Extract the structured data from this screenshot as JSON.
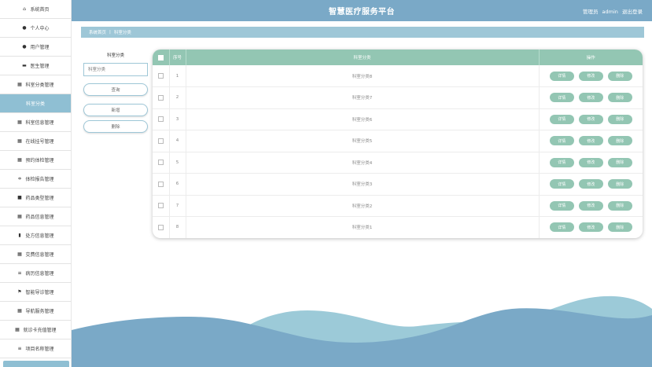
{
  "header": {
    "title": "智慧医疗服务平台",
    "role_prefix": "管理员",
    "username": "admin",
    "logout_label": "退出登录"
  },
  "sidebar": {
    "items": [
      {
        "label": "系统首页",
        "icon": "home-icon",
        "glyph": "⌂"
      },
      {
        "label": "个人中心",
        "icon": "user-icon",
        "glyph": "●"
      },
      {
        "label": "用户管理",
        "icon": "user-icon",
        "glyph": "●"
      },
      {
        "label": "医生管理",
        "icon": "briefcase-icon",
        "glyph": "▬"
      },
      {
        "label": "科室分类管理",
        "icon": "grid-icon",
        "glyph": "▦"
      },
      {
        "label": "科室分类",
        "icon": "",
        "glyph": "",
        "active": true
      },
      {
        "label": "科室信息管理",
        "icon": "grid-icon",
        "glyph": "▦"
      },
      {
        "label": "在线挂号管理",
        "icon": "grid-icon",
        "glyph": "▦"
      },
      {
        "label": "预约体检管理",
        "icon": "grid-icon",
        "glyph": "▦"
      },
      {
        "label": "体检报告管理",
        "icon": "sliders-icon",
        "glyph": "≑"
      },
      {
        "label": "药品类型管理",
        "icon": "checkbox-icon",
        "glyph": "■"
      },
      {
        "label": "药品信息管理",
        "icon": "grid-icon",
        "glyph": "▦"
      },
      {
        "label": "处方信息管理",
        "icon": "clipboard-icon",
        "glyph": "▮"
      },
      {
        "label": "交费信息管理",
        "icon": "table-icon",
        "glyph": "▦"
      },
      {
        "label": "病历信息管理",
        "icon": "list-icon",
        "glyph": "≡"
      },
      {
        "label": "智能导诊管理",
        "icon": "flag-icon",
        "glyph": "⚑"
      },
      {
        "label": "导航服务管理",
        "icon": "grid-icon",
        "glyph": "▦"
      },
      {
        "label": "就诊卡充值管理",
        "icon": "grid-icon",
        "glyph": "▦"
      },
      {
        "label": "项目名称管理",
        "icon": "list-icon",
        "glyph": "≡"
      }
    ]
  },
  "breadcrumb": {
    "home": "系统首页",
    "separator": "|",
    "current": "科室分类"
  },
  "search": {
    "label": "科室分类",
    "placeholder": "科室分类",
    "query_button": "查询",
    "add_button": "新增",
    "delete_button": "删除"
  },
  "table": {
    "headers": {
      "index": "序号",
      "name": "科室分类",
      "actions": "操作"
    },
    "action_labels": {
      "detail": "详情",
      "edit": "修改",
      "delete": "删除"
    },
    "rows": [
      {
        "index": "1",
        "name": "科室分类8"
      },
      {
        "index": "2",
        "name": "科室分类7"
      },
      {
        "index": "3",
        "name": "科室分类6"
      },
      {
        "index": "4",
        "name": "科室分类5"
      },
      {
        "index": "5",
        "name": "科室分类4"
      },
      {
        "index": "6",
        "name": "科室分类3"
      },
      {
        "index": "7",
        "name": "科室分类2"
      },
      {
        "index": "8",
        "name": "科室分类1"
      }
    ]
  },
  "colors": {
    "header_bg": "#7aa9c7",
    "accent_green": "#93c6b3",
    "breadcrumb_bg": "#9ec7d7",
    "wave_dark": "#7aa9c7",
    "wave_light": "#9ccad8"
  }
}
